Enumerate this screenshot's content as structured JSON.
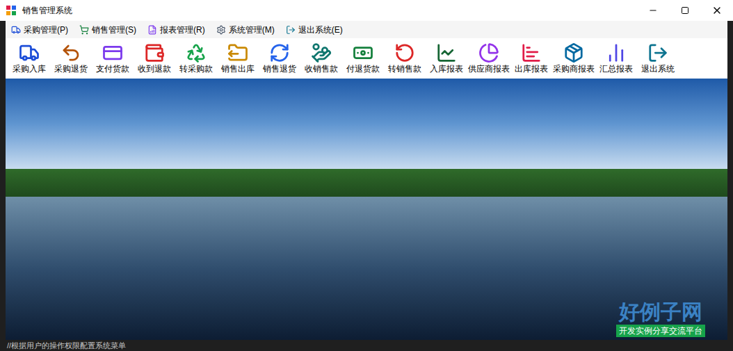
{
  "window": {
    "title": "销售管理系统"
  },
  "menu": [
    {
      "label": "采购管理(P)"
    },
    {
      "label": "销售管理(S)"
    },
    {
      "label": "报表管理(R)"
    },
    {
      "label": "系统管理(M)"
    },
    {
      "label": "退出系统(E)"
    }
  ],
  "toolbar": [
    {
      "label": "采购入库"
    },
    {
      "label": "采购退货"
    },
    {
      "label": "支付货款"
    },
    {
      "label": "收到退款"
    },
    {
      "label": "转采购款"
    },
    {
      "label": "销售出库"
    },
    {
      "label": "销售退货"
    },
    {
      "label": "收销售款"
    },
    {
      "label": "付退货款"
    },
    {
      "label": "转销售款"
    },
    {
      "label": "入库报表"
    },
    {
      "label": "供应商报表"
    },
    {
      "label": "出库报表"
    },
    {
      "label": "采购商报表"
    },
    {
      "label": "汇总报表"
    },
    {
      "label": "退出系统"
    }
  ],
  "watermark": {
    "title": "好例子网",
    "subtitle": "开发实例分享交流平台"
  },
  "status_text": "//根据用户的操作权限配置系统菜单"
}
